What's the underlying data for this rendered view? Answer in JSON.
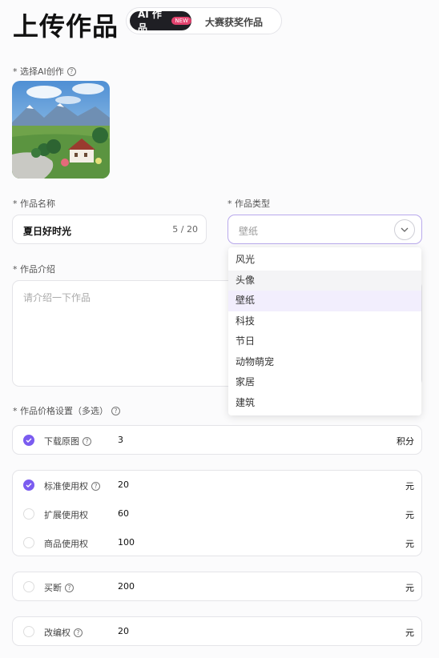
{
  "header": {
    "title": "上传作品",
    "tab_active": "AI 作品",
    "tab_active_badge": "NEW",
    "tab_other": "大赛获奖作品"
  },
  "artwork": {
    "label": "* 选择AI创作",
    "help_icon": "question-circle-icon"
  },
  "name_field": {
    "label": "* 作品名称",
    "value": "夏日好时光",
    "counter": "5 / 20"
  },
  "type_field": {
    "label": "* 作品类型",
    "placeholder": "壁纸",
    "options": [
      "风光",
      "头像",
      "壁纸",
      "科技",
      "节日",
      "动物萌宠",
      "家居",
      "建筑"
    ],
    "hovered": "头像",
    "selected": "壁纸"
  },
  "intro_field": {
    "label": "* 作品介绍",
    "placeholder": "请介绍一下作品"
  },
  "price": {
    "label": "* 作品价格设置（多选）",
    "download": {
      "name": "下载原图",
      "value": "3",
      "unit": "积分",
      "checked": true
    },
    "standard": {
      "name": "标准使用权",
      "value": "20",
      "unit": "元",
      "checked": true
    },
    "extended": {
      "name": "扩展使用权",
      "value": "60",
      "unit": "元",
      "checked": false
    },
    "commercial": {
      "name": "商品使用权",
      "value": "100",
      "unit": "元",
      "checked": false
    },
    "buyout": {
      "name": "买断",
      "value": "200",
      "unit": "元",
      "checked": false
    },
    "adapt": {
      "name": "改编权",
      "value": "20",
      "unit": "元",
      "checked": false
    }
  },
  "colors": {
    "accent": "#7b5cf0",
    "dark_pill": "#1f1f24",
    "new_badge": "#e2426e"
  }
}
